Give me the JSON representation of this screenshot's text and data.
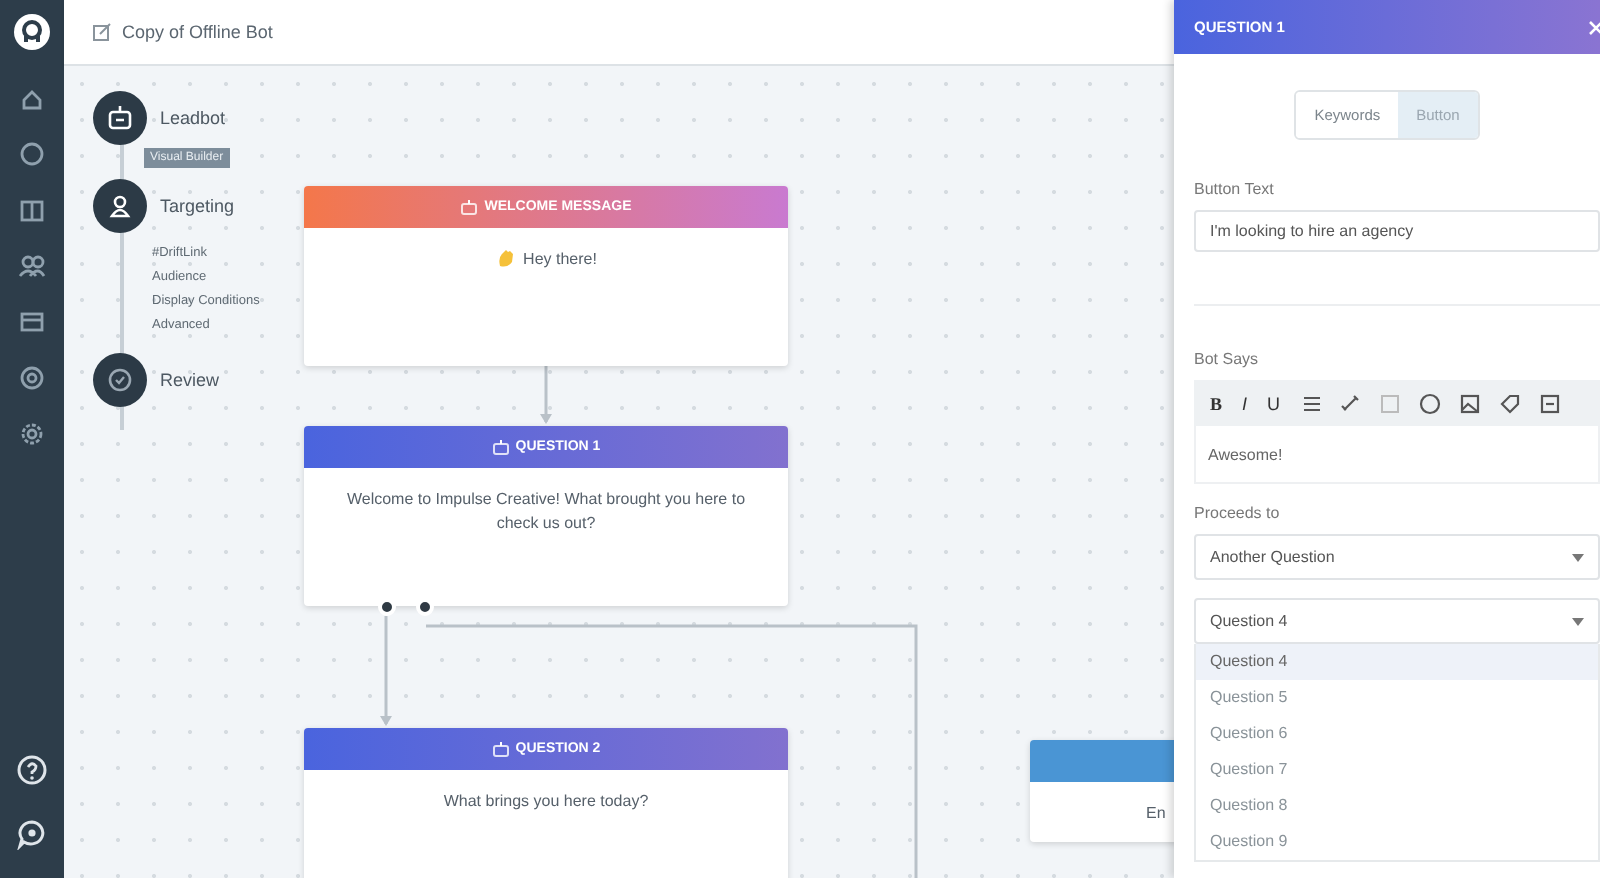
{
  "header": {
    "title": "Copy of Offline Bot"
  },
  "steps": [
    {
      "kind": "bot",
      "label": "Leadbot",
      "badge": "Visual Builder"
    },
    {
      "kind": "person",
      "label": "Targeting",
      "substeps": [
        "#DriftLink",
        "Audience",
        "Display Conditions",
        "Advanced"
      ]
    },
    {
      "kind": "check",
      "label": "Review"
    }
  ],
  "nodes": [
    {
      "kind": "welcome",
      "title": "WELCOME MESSAGE",
      "body": "Hey there!"
    },
    {
      "kind": "question",
      "title": "QUESTION 1",
      "body": "Welcome to Impulse Creative! What brought you here to check us out?"
    },
    {
      "kind": "question",
      "title": "QUESTION 2",
      "body": "What brings you here today?"
    },
    {
      "kind": "end",
      "body": "En"
    }
  ],
  "panel": {
    "title": "QUESTION 1",
    "tabs": [
      {
        "label": "Keywords",
        "selected": false
      },
      {
        "label": "Button",
        "selected": true
      }
    ],
    "button_text": {
      "label": "Button Text",
      "value": "I'm looking to hire an agency"
    },
    "bot_says": {
      "label": "Bot Says",
      "toolbar": [
        "B",
        "I",
        "U"
      ],
      "value": "Awesome!"
    },
    "proceeds_to": {
      "label": "Proceeds to",
      "value": "Another Question"
    },
    "question_select": {
      "value": "Question 4",
      "expanded": true,
      "options": [
        {
          "label": "Question 4",
          "selected": true
        },
        {
          "label": "Question 5",
          "selected": false
        },
        {
          "label": "Question 6",
          "selected": false
        },
        {
          "label": "Question 7",
          "selected": false
        },
        {
          "label": "Question 8",
          "selected": false
        },
        {
          "label": "Question 9",
          "selected": false
        }
      ]
    }
  }
}
